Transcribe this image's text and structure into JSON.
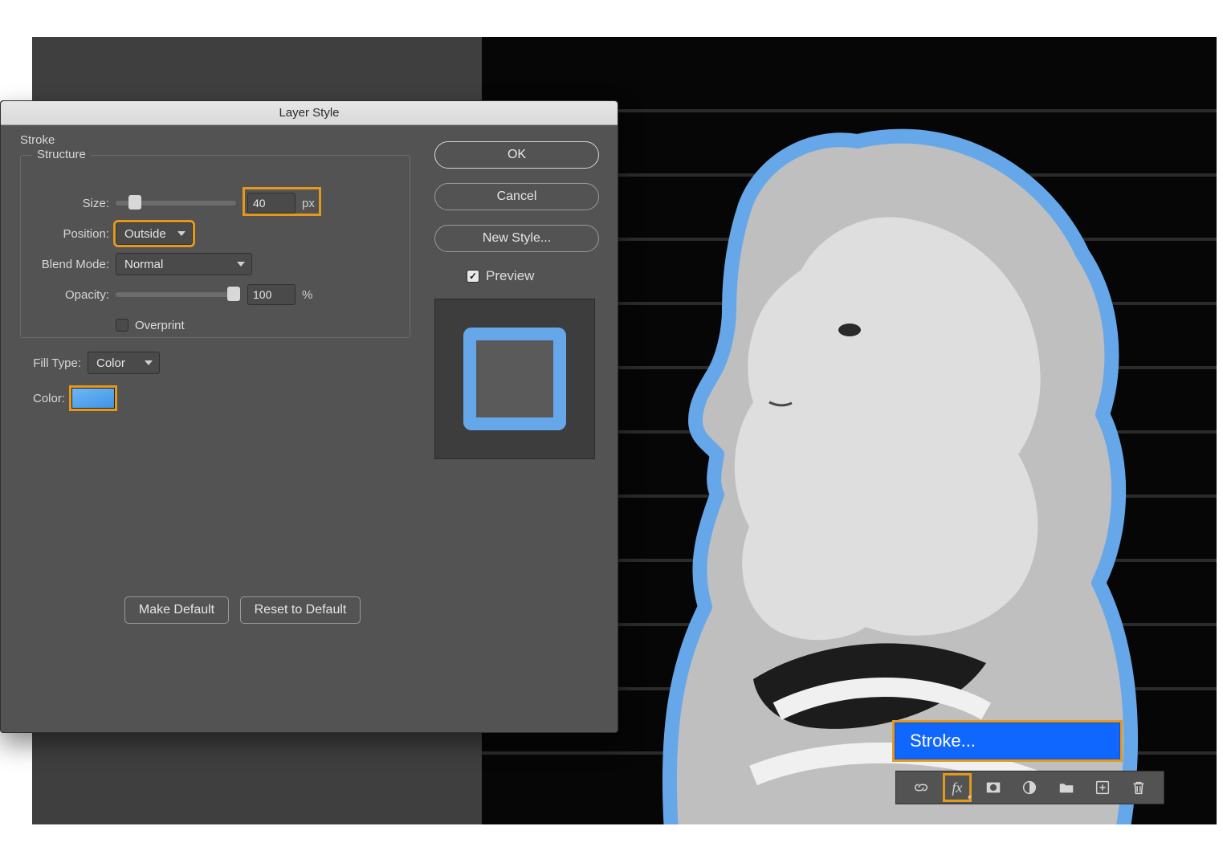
{
  "dialog": {
    "title": "Layer Style",
    "section": "Stroke",
    "structure_legend": "Structure",
    "size_label": "Size:",
    "size_value": "40",
    "size_unit": "px",
    "position_label": "Position:",
    "position_value": "Outside",
    "blend_label": "Blend Mode:",
    "blend_value": "Normal",
    "opacity_label": "Opacity:",
    "opacity_value": "100",
    "opacity_unit": "%",
    "overprint_label": "Overprint",
    "filltype_label": "Fill Type:",
    "filltype_value": "Color",
    "color_label": "Color:",
    "make_default": "Make Default",
    "reset_default": "Reset to Default",
    "ok": "OK",
    "cancel": "Cancel",
    "new_style": "New Style...",
    "preview_label": "Preview"
  },
  "popup": {
    "stroke_item": "Stroke..."
  },
  "colors": {
    "stroke": "#66a7ea",
    "highlight": "#e4981c"
  }
}
